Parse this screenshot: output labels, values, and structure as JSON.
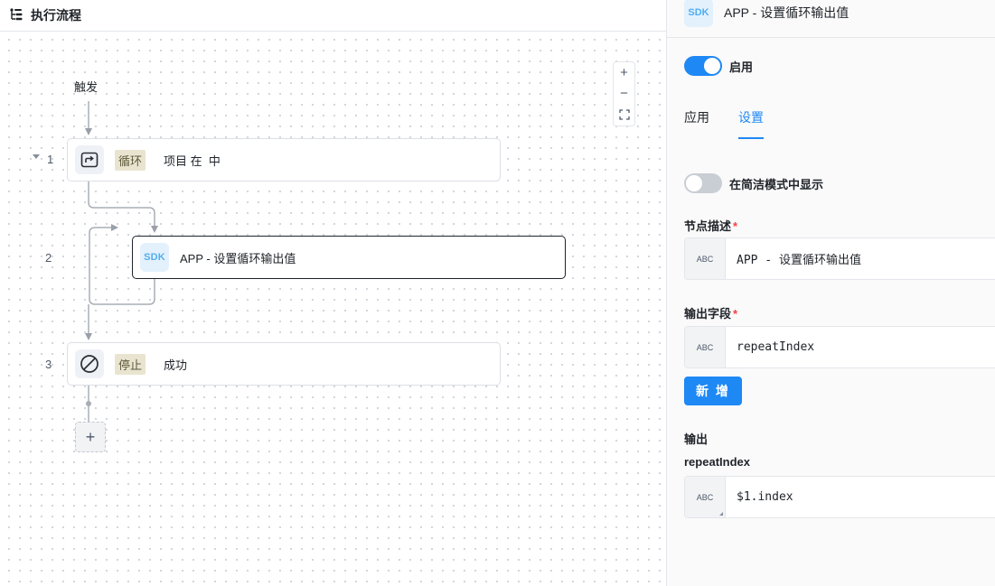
{
  "left_panel": {
    "title": "执行流程",
    "trigger_label": "触发",
    "steps": [
      {
        "number": "1",
        "tag": "循环",
        "text": "项目 在  中"
      },
      {
        "number": "2",
        "icon_label": "SDK",
        "text": "APP - 设置循环输出值"
      },
      {
        "number": "3",
        "tag": "停止",
        "text": "成功"
      }
    ],
    "add_button": "+",
    "zoom": {
      "in": "+",
      "out": "−"
    }
  },
  "right_panel": {
    "header_icon": "SDK",
    "header_title": "APP - 设置循环输出值",
    "enable_label": "启用",
    "enable_on": true,
    "tabs": [
      {
        "label": "应用"
      },
      {
        "label": "设置",
        "active": true
      }
    ],
    "compact_mode_label": "在简洁模式中显示",
    "compact_mode_on": false,
    "node_desc_label": "节点描述",
    "node_desc_required": "*",
    "node_desc_type": "ABC",
    "node_desc_value": "APP - 设置循环输出值",
    "output_field_label": "输出字段",
    "output_field_required": "*",
    "output_field_type": "ABC",
    "output_field_value": "repeatIndex",
    "add_button": "新 增",
    "output_section_label": "输出",
    "output_name": "repeatIndex",
    "output_type": "ABC",
    "output_value": "$1.index"
  },
  "colors": {
    "accent": "#1e88f5",
    "tag_bg": "#e9e4cf",
    "sdk_text": "#52aef0",
    "required": "#f53f3f"
  }
}
